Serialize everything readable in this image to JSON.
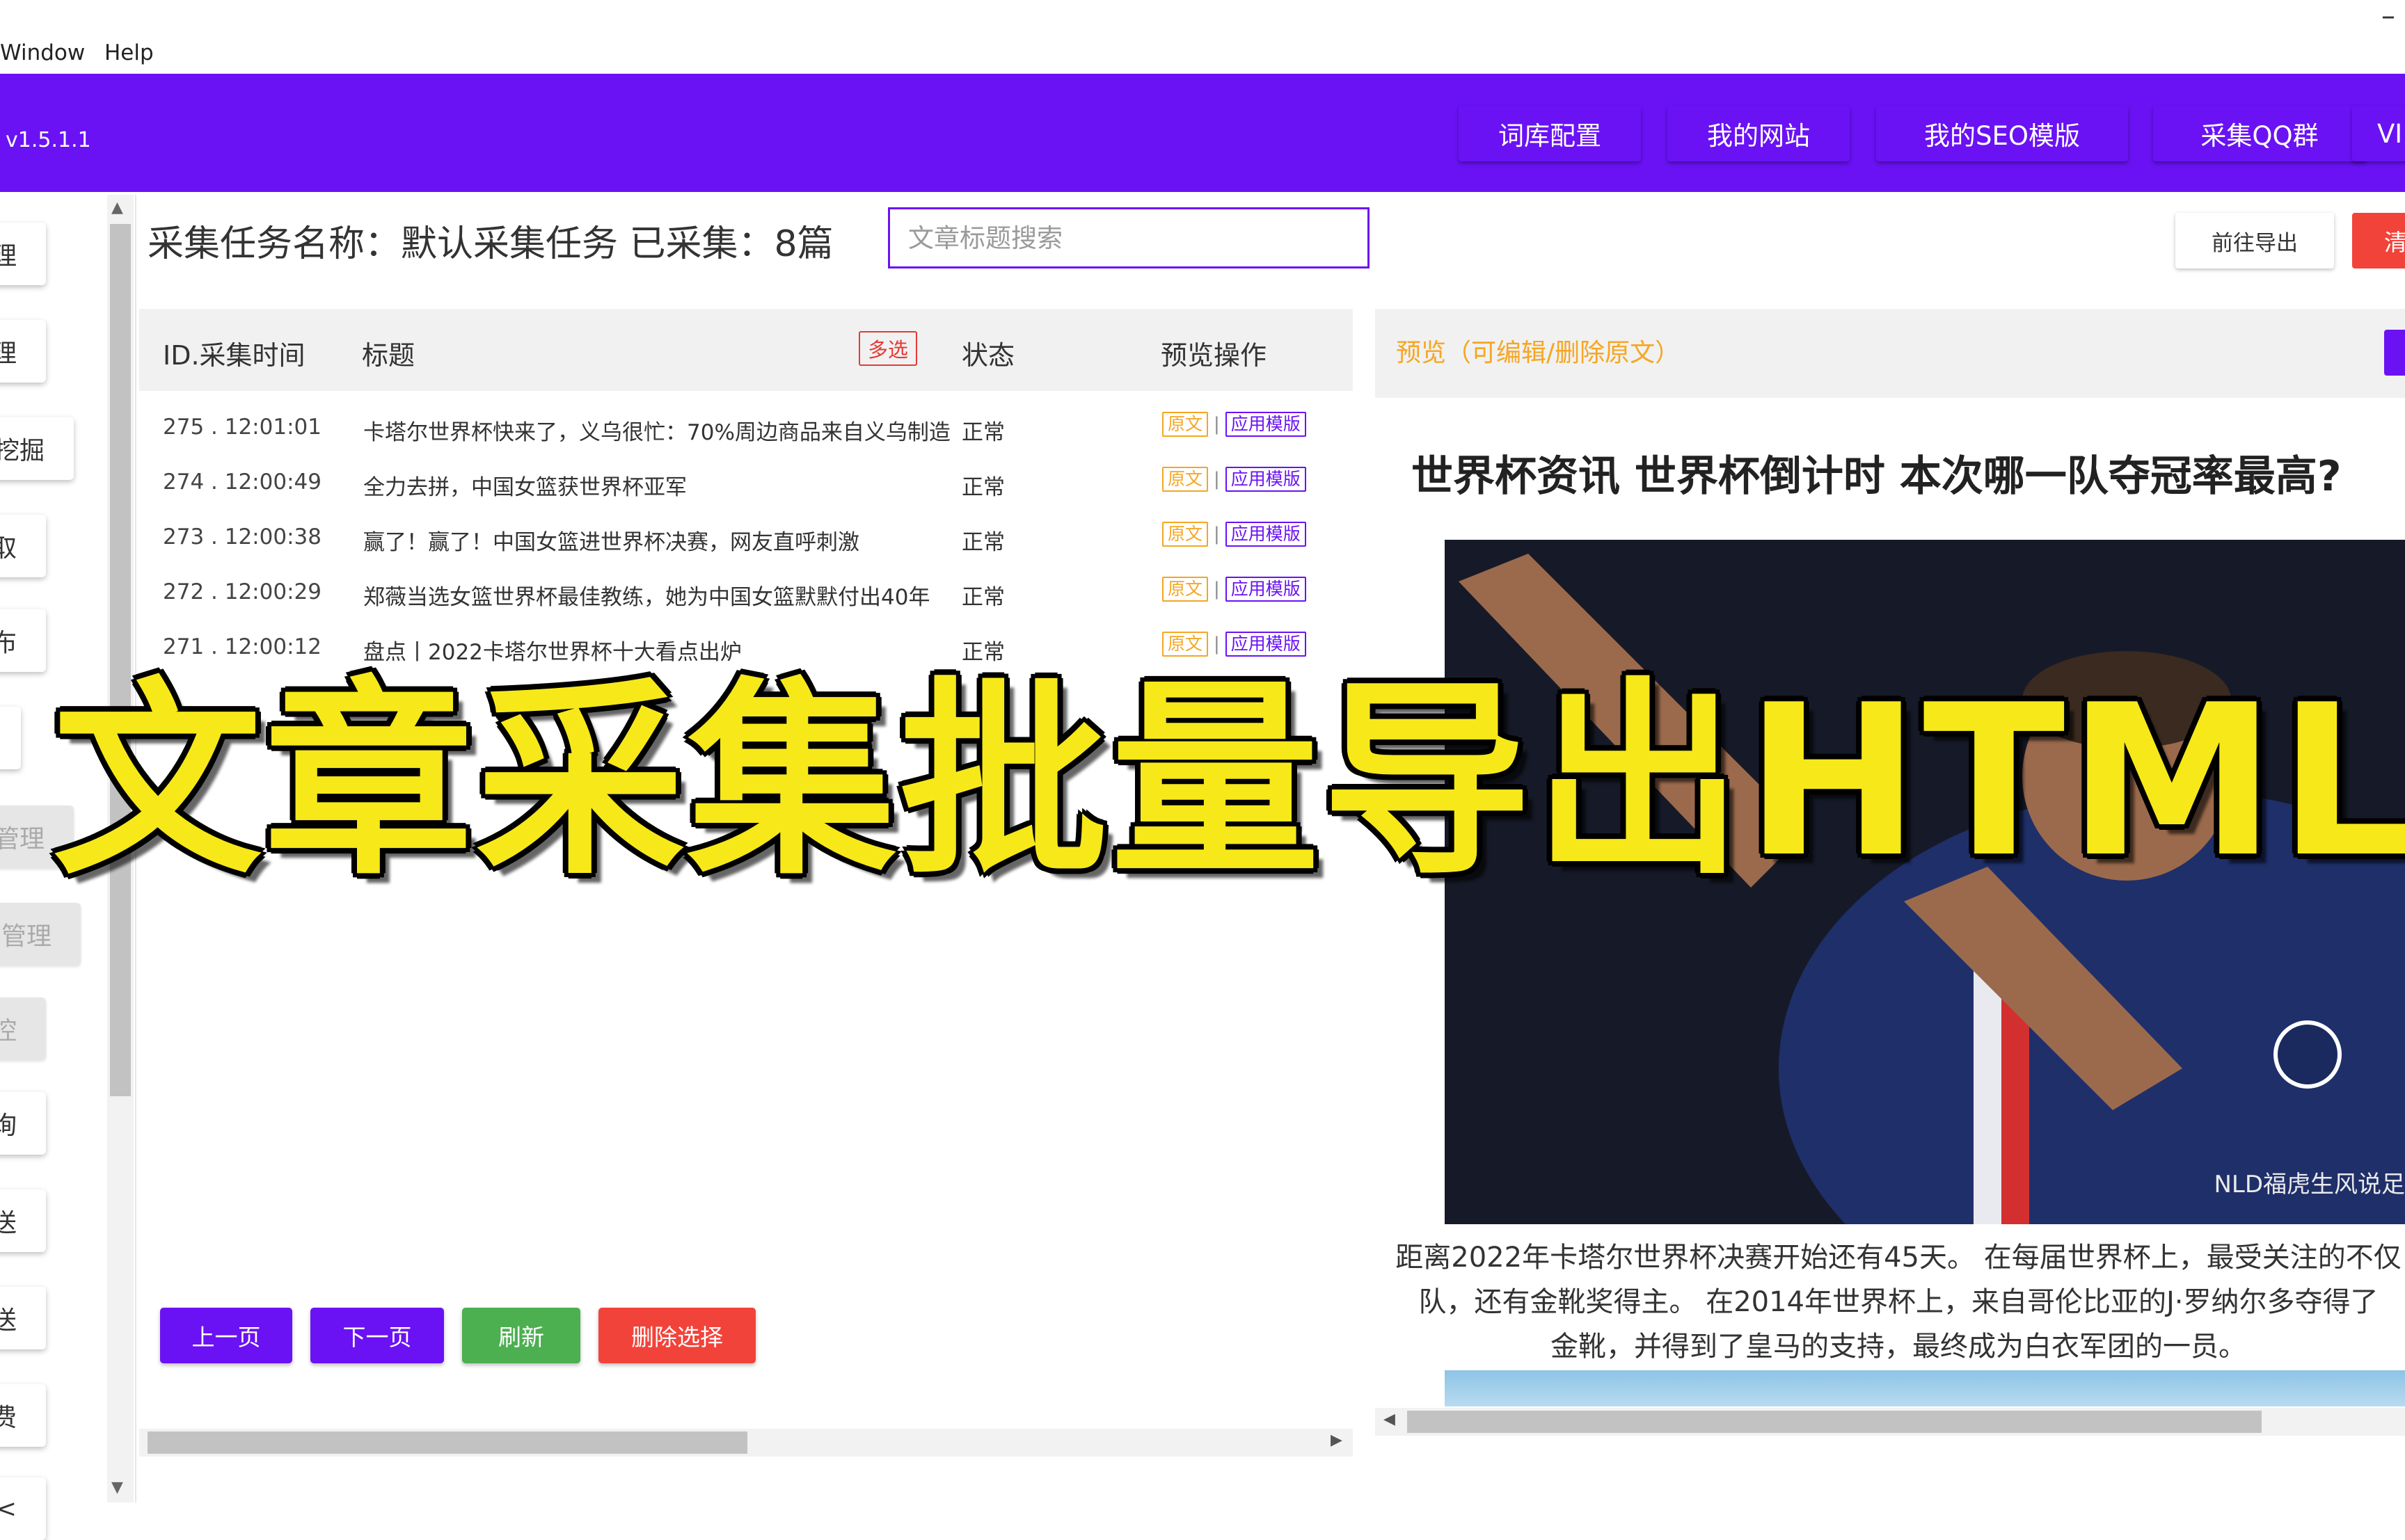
{
  "menubar": {
    "items": [
      "Window",
      "Help"
    ],
    "min_glyph": "–"
  },
  "header": {
    "version": "v1.5.1.1",
    "nav": [
      "词库配置",
      "我的网站",
      "我的SEO模版",
      "采集QQ群",
      "VI"
    ]
  },
  "sidebar": {
    "items": [
      "理",
      "理",
      "挖掘",
      "取",
      "布",
      "",
      "管理",
      "管理",
      "控",
      "询",
      "送",
      "送",
      "费",
      "<"
    ]
  },
  "task": {
    "label": "采集任务名称：默认采集任务 已采集：8篇",
    "search_placeholder": "文章标题搜索",
    "export_label": "前往导出",
    "clear_label": "清"
  },
  "table": {
    "headers": {
      "id_time": "ID.采集时间",
      "title": "标题",
      "multi": "多选",
      "status": "状态",
      "ops": "预览操作"
    },
    "op_orig": "原文",
    "op_sep": "|",
    "op_tpl": "应用模版",
    "rows": [
      {
        "id_time": "275 . 12:01:01",
        "title": "卡塔尔世界杯快来了，义乌很忙：70%周边商品来自义乌制造",
        "status": "正常"
      },
      {
        "id_time": "274 . 12:00:49",
        "title": "全力去拼，中国女篮获世界杯亚军",
        "status": "正常"
      },
      {
        "id_time": "273 . 12:00:38",
        "title": "赢了！赢了！中国女篮进世界杯决赛，网友直呼刺激",
        "status": "正常"
      },
      {
        "id_time": "272 . 12:00:29",
        "title": "郑薇当选女篮世界杯最佳教练，她为中国女篮默默付出40年",
        "status": "正常"
      },
      {
        "id_time": "271 . 12:00:12",
        "title": "盘点丨2022卡塔尔世界杯十大看点出炉",
        "status": "正常"
      }
    ]
  },
  "pagination": {
    "prev": "上一页",
    "next": "下一页",
    "refresh": "刷新",
    "delete": "删除选择"
  },
  "preview": {
    "label": "预览（可编辑/删除原文）",
    "article_title": "世界杯资讯 世界杯倒计时 本次哪一队夺冠率最高?",
    "watermark": "NLD福虎生风说足",
    "body_line1": "距离2022年卡塔尔世界杯决赛开始还有45天。 在每届世界杯上，最受关注的不仅",
    "body_line2": "队，还有金靴奖得主。 在2014年世界杯上，来自哥伦比亚的J·罗纳尔多夺得了",
    "body_line3": "金靴，并得到了皇马的支持，最终成为白衣军团的一员。"
  },
  "overlay": {
    "caption": "文章采集批量导出HTML"
  },
  "colors": {
    "brand": "#6a12f4",
    "danger": "#f2433a",
    "success": "#4caf50",
    "warning": "#f5a623",
    "overlay_text": "#f7e81a"
  }
}
